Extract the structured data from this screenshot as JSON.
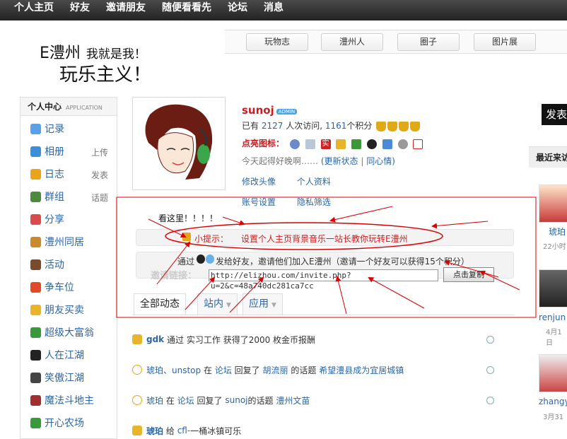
{
  "topnav": [
    "个人主页",
    "好友",
    "邀请朋友",
    "随便看看先",
    "论坛",
    "消息"
  ],
  "logo": {
    "line1": "E澧州",
    "line1_sub": "我就是我！",
    "line2": "玩乐主义！"
  },
  "site_tabs": [
    "玩物志",
    "澧州人",
    "圈子",
    "图片展"
  ],
  "sidebar": {
    "title": "个人中心",
    "title_en": "APPLICATION",
    "items": [
      {
        "label": "记录",
        "side": "",
        "icon": "chat-icon",
        "color": "#5aa0e6"
      },
      {
        "label": "相册",
        "side": "上传",
        "icon": "photo-icon",
        "color": "#3c8fd6"
      },
      {
        "label": "日志",
        "side": "发表",
        "icon": "blog-icon",
        "color": "#e8a41a"
      },
      {
        "label": "群组",
        "side": "话题",
        "icon": "group-icon",
        "color": "#4a8a3c"
      },
      {
        "label": "分享",
        "side": "",
        "icon": "share-icon",
        "color": "#d94a4a"
      },
      {
        "label": "澧州同居",
        "side": "",
        "icon": "house-icon",
        "color": "#c98a2a"
      },
      {
        "label": "活动",
        "side": "",
        "icon": "boot-icon",
        "color": "#7a4a2a"
      },
      {
        "label": "争车位",
        "side": "",
        "icon": "parking-icon",
        "color": "#e04a2a"
      },
      {
        "label": "朋友买卖",
        "side": "",
        "icon": "coins-icon",
        "color": "#e8b42a"
      },
      {
        "label": "超级大富翁",
        "side": "",
        "icon": "money-icon",
        "color": "#3a9a3a"
      },
      {
        "label": "人在江湖",
        "side": "",
        "icon": "jianghu-icon",
        "color": "#222222"
      },
      {
        "label": "笑傲江湖",
        "side": "",
        "icon": "sword-icon",
        "color": "#444444"
      },
      {
        "label": "魔法斗地主",
        "side": "",
        "icon": "wizard-icon",
        "color": "#a03030"
      },
      {
        "label": "开心农场",
        "side": "",
        "icon": "sprout-icon",
        "color": "#3a9a3a"
      }
    ]
  },
  "profile": {
    "username": "sunoj",
    "badge": "ADMIN",
    "visits_prefix": "已有",
    "visits": "2127",
    "visits_suffix": "人次访问,",
    "points": "1161",
    "points_suffix": "个积分",
    "icons_label": "点亮图标：",
    "status": "今天起得好晚啊……",
    "update_status": "(更新状态",
    "sep": "|",
    "same_heart": "同心情)",
    "links": [
      "修改头像",
      "个人资料",
      "账号设置",
      "隐私筛选"
    ]
  },
  "annotation_text": "看这里！！！！",
  "hint": {
    "label": "小提示：",
    "text": "设置个人主页背景音乐一站长教你玩转E澧州"
  },
  "invite": {
    "prefix": "通过",
    "text": "发给好友，邀请他们加入E澧州（邀请一个好友可以获得15个积分）",
    "label": "邀请链接：",
    "url": "http://elizhou.com/invite.php?u=2&c=48a740dc281ca7cc",
    "copy_button": "点击复制"
  },
  "feed_tabs": [
    "全部动态",
    "站内",
    "应用"
  ],
  "feed": [
    {
      "actor": "gdk",
      "parts": [
        "通过",
        "实习工作",
        "获得了2000 枚金币报酬"
      ]
    },
    {
      "actor": "琥珀、unstop",
      "parts": [
        "在",
        "论坛",
        "回复了",
        "胡流丽",
        "的话题",
        "希望澧县成为宜居城镇"
      ]
    },
    {
      "actor": "琥珀",
      "parts": [
        "在",
        "论坛",
        "回复了",
        "sunoj",
        "的话题",
        "澧州文苗"
      ]
    },
    {
      "actor": "琥珀",
      "parts": [
        "给",
        "cfl-",
        "一桶冰镇可乐"
      ]
    }
  ],
  "right": {
    "publish": "发表",
    "recent_title": "最近来访",
    "visitors": [
      {
        "name": "琥珀",
        "time": "22小时"
      },
      {
        "name": "renjun",
        "time": "4月1日"
      },
      {
        "name": "zhangy",
        "time": "3月31"
      }
    ]
  }
}
